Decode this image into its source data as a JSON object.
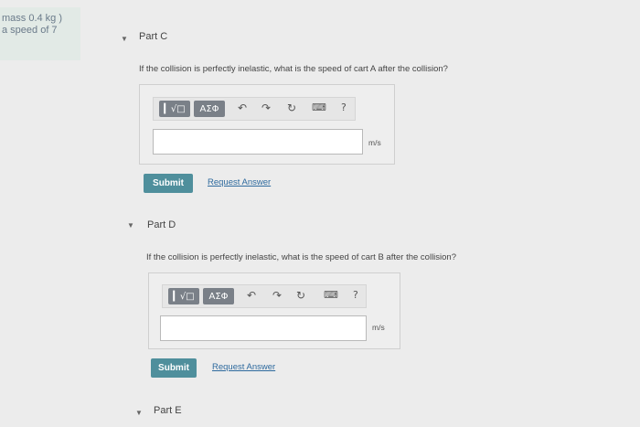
{
  "context_note": {
    "line1": "mass 0.4 kg )",
    "line2": "a speed of 7"
  },
  "parts": [
    {
      "title": "Part C",
      "question": "If the collision is perfectly inelastic, what is the speed of cart A after the collision?",
      "toolbar": {
        "templates": "▎√□",
        "symbols": "ΑΣΦ",
        "help": "?"
      },
      "answer_value": "",
      "unit": "m/s",
      "submit_label": "Submit",
      "request_label": "Request Answer"
    },
    {
      "title": "Part D",
      "question": "If the collision is perfectly inelastic, what is the speed of cart B after the collision?",
      "toolbar": {
        "templates": "▎√□",
        "symbols": "ΑΣΦ",
        "help": "?"
      },
      "answer_value": "",
      "unit": "m/s",
      "submit_label": "Submit",
      "request_label": "Request Answer"
    },
    {
      "title": "Part E"
    }
  ],
  "icons": {
    "caret": "caret-down-icon",
    "undo": "undo-icon",
    "redo": "redo-icon",
    "reset": "reset-icon",
    "keyboard": "keyboard-icon",
    "help": "help-icon"
  },
  "colors": {
    "submit": "#4f8f9c",
    "link": "#2e6a9e",
    "tool_button": "#7a8088"
  }
}
